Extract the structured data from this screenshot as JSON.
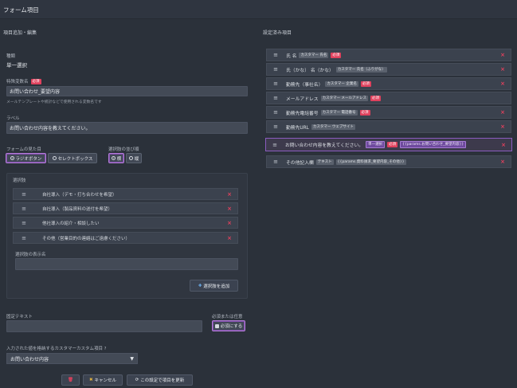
{
  "header": {
    "title": "フォーム項目"
  },
  "left": {
    "title": "項目追加・編集",
    "kind_label": "種類",
    "kind_value": "単一選択",
    "field_name_label": "特殊変数名",
    "required_badge": "必須",
    "field_name_value": "お問い合わせ_要望内容",
    "field_name_hint": "メールテンプレートや統計などで使用される変数名です",
    "label_label": "ラベル",
    "label_value": "お問い合わせ内容を教えてください。",
    "appearance_label": "フォームの見た目",
    "appearance_options": [
      "ラジオボタン",
      "セレクトボックス"
    ],
    "order_label": "選択肢の並び順",
    "order_options": [
      "横",
      "縦"
    ],
    "choices_label": "選択肢",
    "choices": [
      "自社導入（デモ・打ち合わせを希望）",
      "自社導入（製品資料の送付を希望）",
      "他社導入の紹介・相談したい",
      "その他（営業目的の連絡はご遠慮ください）"
    ],
    "choice_display_label": "選択肢の表示名",
    "choice_display_value": "",
    "add_choice_button": "選択肢を追加",
    "fixed_text_label": "固定テキスト",
    "fixed_text_value": "",
    "required_or_optional_label": "必須または任意",
    "required_toggle": "必須にする",
    "custom_field_label": "入力された値を格納するカスタマーカスタム項目",
    "custom_field_value": "お問い合わせ内容",
    "delete_icon": "trash-icon",
    "cancel_button": "キャンセル",
    "update_button": "この設定で項目を更新"
  },
  "right": {
    "title": "設定済み項目",
    "rows": [
      {
        "label": "氏 名",
        "tag": "カスタマー 氏名",
        "required": true
      },
      {
        "label": "氏（かな） 名（かな）",
        "tag": "カスタマー 氏名（ふりがな）",
        "required": false
      },
      {
        "label": "勤務先（事社名）",
        "tag": "カスタマー 企業名",
        "required": true
      },
      {
        "label": "メールアドレス",
        "tag": "カスタマー メールアドレス",
        "required": true
      },
      {
        "label": "勤務先電話番号",
        "tag": "カスタマー 電話番号",
        "required": true
      },
      {
        "label": "勤務先URL",
        "tag": "カスタマー ウェブサイト",
        "required": false
      },
      {
        "label": "お問い合わせ内容を教えてください。",
        "tag": "単一選択",
        "required": true,
        "extra": "{{params.お問い合わせ_要望内容}}",
        "selected": true
      },
      {
        "label": "その他記入欄",
        "tag": "テキスト",
        "required": false,
        "extra": "{{params.資料請求_要望内容_その他}}"
      }
    ],
    "drag_icon": "drag-handle-icon",
    "remove_icon": "close-icon"
  },
  "colors": {
    "background": "#2b313a",
    "accent_required": "#e0415d",
    "selected_border": "#8b5cbf",
    "add_icon": "#6cb1f0",
    "cancel_icon": "#e0b341"
  }
}
